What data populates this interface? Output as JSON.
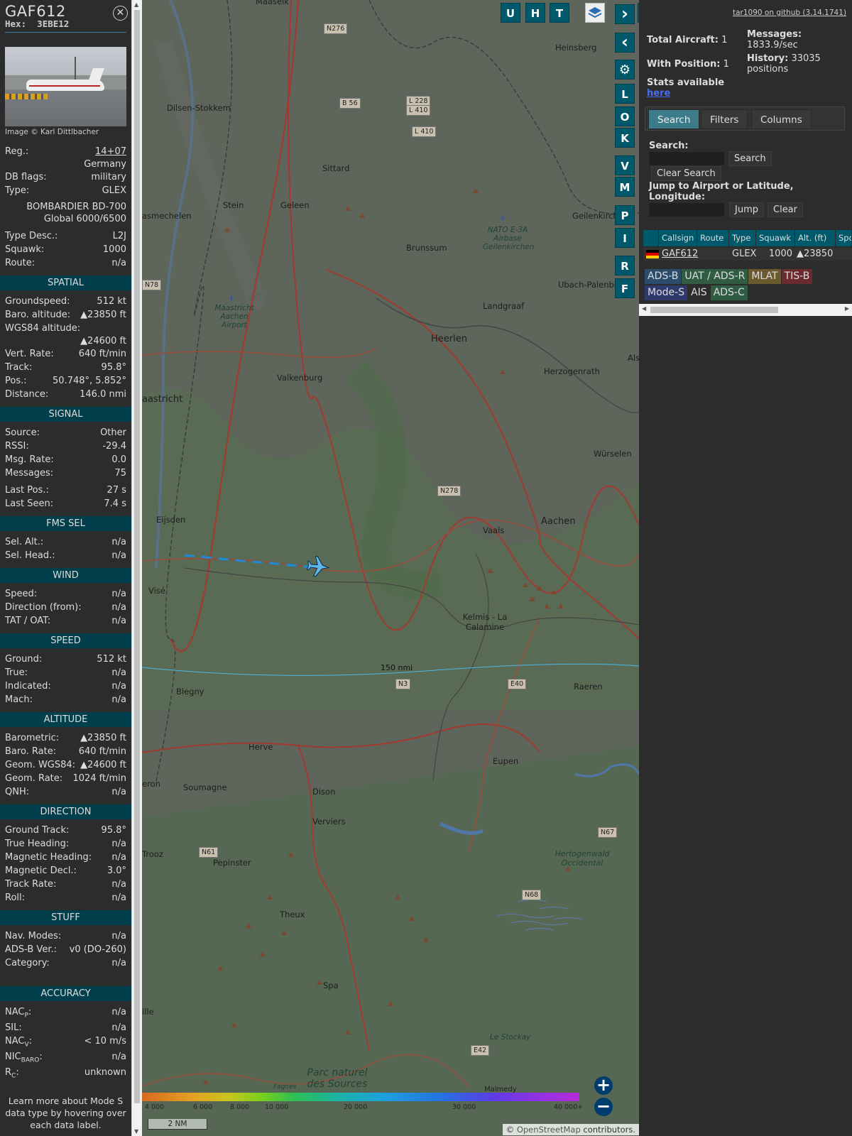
{
  "aircraft": {
    "callsign": "GAF612",
    "hex_label": "Hex:",
    "hex": "3EBE12",
    "photo_credit": "Image © Karl Dittlbacher"
  },
  "info": {
    "reg_k": "Reg.:",
    "reg_v": "14+07",
    "country": "Germany",
    "dbflags_k": "DB flags:",
    "dbflags_v": "military",
    "type_k": "Type:",
    "type_v": "GLEX",
    "type_name1": "BOMBARDIER BD-700",
    "type_name2": "Global 6000/6500",
    "typedesc_k": "Type Desc.:",
    "typedesc_v": "L2J",
    "squawk_k": "Squawk:",
    "squawk_v": "1000",
    "route_k": "Route:",
    "route_v": "n/a"
  },
  "spatial": {
    "title": "SPATIAL",
    "gs_k": "Groundspeed:",
    "gs_v": "512 kt",
    "baro_k": "Baro. altitude:",
    "baro_v": "▲23850 ft",
    "wgs_k": "WGS84 altitude:",
    "wgs_v": "▲24600 ft",
    "vr_k": "Vert. Rate:",
    "vr_v": "640 ft/min",
    "track_k": "Track:",
    "track_v": "95.8°",
    "pos_k": "Pos.:",
    "pos_v": "50.748°, 5.852°",
    "dist_k": "Distance:",
    "dist_v": "146.0 nmi"
  },
  "signal": {
    "title": "SIGNAL",
    "src_k": "Source:",
    "src_v": "Other",
    "rssi_k": "RSSI:",
    "rssi_v": "-29.4",
    "msgrate_k": "Msg. Rate:",
    "msgrate_v": "0.0",
    "msgs_k": "Messages:",
    "msgs_v": "75",
    "lastpos_k": "Last Pos.:",
    "lastpos_v": "27 s",
    "lastseen_k": "Last Seen:",
    "lastseen_v": "7.4 s"
  },
  "fms": {
    "title": "FMS SEL",
    "selalt_k": "Sel. Alt.:",
    "selalt_v": "n/a",
    "selhead_k": "Sel. Head.:",
    "selhead_v": "n/a"
  },
  "wind": {
    "title": "WIND",
    "speed_k": "Speed:",
    "speed_v": "n/a",
    "dir_k": "Direction (from):",
    "dir_v": "n/a",
    "tat_k": "TAT / OAT:",
    "tat_v": "n/a"
  },
  "speed": {
    "title": "SPEED",
    "ground_k": "Ground:",
    "ground_v": "512 kt",
    "true_k": "True:",
    "true_v": "n/a",
    "ind_k": "Indicated:",
    "ind_v": "n/a",
    "mach_k": "Mach:",
    "mach_v": "n/a"
  },
  "altitude": {
    "title": "ALTITUDE",
    "baro_k": "Barometric:",
    "baro_v": "▲23850 ft",
    "barorate_k": "Baro. Rate:",
    "barorate_v": "640 ft/min",
    "geom_k": "Geom. WGS84:",
    "geom_v": "▲24600 ft",
    "geomrate_k": "Geom. Rate:",
    "geomrate_v": "1024 ft/min",
    "qnh_k": "QNH:",
    "qnh_v": "n/a"
  },
  "direction": {
    "title": "DIRECTION",
    "gtrack_k": "Ground Track:",
    "gtrack_v": "95.8°",
    "thead_k": "True Heading:",
    "thead_v": "n/a",
    "mhead_k": "Magnetic Heading:",
    "mhead_v": "n/a",
    "mdecl_k": "Magnetic Decl.:",
    "mdecl_v": "3.0°",
    "trate_k": "Track Rate:",
    "trate_v": "n/a",
    "roll_k": "Roll:",
    "roll_v": "n/a"
  },
  "stuff": {
    "title": "STUFF",
    "nav_k": "Nav. Modes:",
    "nav_v": "n/a",
    "adsb_k": "ADS-B Ver.:",
    "adsb_v": "v0 (DO-260)",
    "cat_k": "Category:",
    "cat_v": "n/a"
  },
  "accuracy": {
    "title": "ACCURACY",
    "nacp_k": "NAC",
    "nacp_sub": "P",
    "nacp_v": "n/a",
    "sil_k": "SIL:",
    "sil_v": "n/a",
    "nacv_k": "NAC",
    "nacv_sub": "V",
    "nacv_v": "< 10 m/s",
    "nic_k": "NIC",
    "nic_sub": "BARO",
    "nic_v": "n/a",
    "rc_k": "R",
    "rc_sub": "C",
    "rc_v": "unknown"
  },
  "learn_more": "Learn more about Mode S data type by hovering over each data label.",
  "map": {
    "buttons": [
      "U",
      "H",
      "T"
    ],
    "side_letters": [
      "L",
      "O",
      "K",
      "V",
      "M",
      "P",
      "I",
      "R",
      "F"
    ],
    "scale_text": "2 NM",
    "range_ring": "150 nmi",
    "attribution_prefix": "© ",
    "attribution_link": "OpenStreetMap",
    "attribution_suffix": " contributors.",
    "alt_labels": [
      "4 000",
      "6 000",
      "8 000",
      "10 000",
      "20 000",
      "30 000",
      "40 000+"
    ],
    "places": {
      "maaseik": "Maaseik",
      "heinsberg": "Heinsberg",
      "dilsen": "Dilsen-Stokkem",
      "sittard": "Sittard",
      "stein": "Stein",
      "geleen": "Geleen",
      "brunssum": "Brunssum",
      "geilenkirchen": "Geilenkirche",
      "nato": "NATO E-3A Airbase Geilenkirchen",
      "asmechelen": "asmechelen",
      "maastricht_airport": "Maastricht Aachen Airport",
      "landgraaf": "Landgraaf",
      "ubach": "Ubach-Palenber",
      "heerlen": "Heerlen",
      "valkenburg": "Valkenburg",
      "herzogenrath": "Herzogenrath",
      "als": "Als",
      "maastricht": "aastricht",
      "wurselen": "Würselen",
      "eijsden": "Eijsden",
      "aachen": "Aachen",
      "vaals": "Vaals",
      "vise": "Visé",
      "kelmis": "Kelmis - La Calamine",
      "blegny": "Blegny",
      "raeren": "Raeren",
      "herve": "Herve",
      "eupen": "Eupen",
      "eron": "eron",
      "soumagne": "Soumagne",
      "dison": "Dison",
      "verviers": "Verviers",
      "trooz": "Trooz",
      "pepinster": "Pepinster",
      "hertogenwald": "Hertogenwald Occidental",
      "theux": "Theux",
      "spa": "Spa",
      "ille": "ille",
      "stockay": "Le Stockay",
      "parc": "Parc naturel des Sources",
      "fagnes": "Fagnes",
      "malmedy": "Malmedy"
    },
    "roads": [
      "N276",
      "B 56",
      "L 228",
      "L 410",
      "L 410",
      "N78",
      "N278",
      "N3",
      "E40",
      "N61",
      "N67",
      "N68",
      "E42"
    ]
  },
  "panel": {
    "total_label": "Total Aircraft:",
    "total_value": "1",
    "withpos_label": "With Position:",
    "withpos_value": "1",
    "messages_label": "Messages:",
    "messages_value": "1833.9/sec",
    "history_label": "History:",
    "history_value": "33035 positions",
    "stats_label": "Stats available",
    "stats_link": "here",
    "github": "tar1090 on github (3.14.1741)",
    "tabs": [
      "Search",
      "Filters",
      "Columns"
    ],
    "search_label": "Search:",
    "search_button": "Search",
    "clear_search": "Clear Search",
    "jump_label": "Jump to Airport or Latitude, Longitude:",
    "jump_button": "Jump",
    "clear_button": "Clear",
    "columns": [
      "Callsign",
      "Route",
      "Type",
      "Squawk",
      "Alt. (ft)",
      "Spd"
    ],
    "row": {
      "callsign": "GAF612",
      "type": "GLEX",
      "squawk": "1000",
      "alt": "▲23850"
    },
    "chips": [
      {
        "label": "ADS-B",
        "color": "#2a4d6b"
      },
      {
        "label": "UAT / ADS-R",
        "color": "#2f5c43"
      },
      {
        "label": "MLAT",
        "color": "#6b5a2e"
      },
      {
        "label": "TIS-B",
        "color": "#6b2a2e"
      },
      {
        "label": "Mode-S",
        "color": "#2e3a6b"
      },
      {
        "label": "AIS",
        "color": "#2c2c2c"
      },
      {
        "label": "ADS-C",
        "color": "#2f5c43"
      }
    ]
  }
}
